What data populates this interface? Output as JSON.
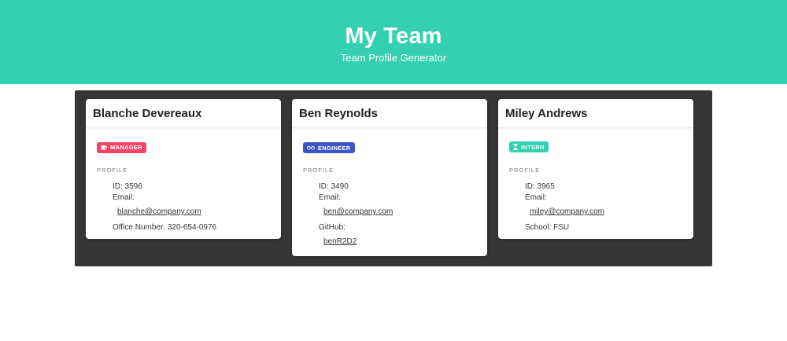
{
  "header": {
    "title": "My Team",
    "subtitle": "Team Profile Generator",
    "background": "#33d0b1"
  },
  "board": {
    "background": "#363636"
  },
  "profile_label": "PROFILE",
  "employees": [
    {
      "name": "Blanche Devereaux",
      "role": "MANAGER",
      "role_icon": "coffee-icon",
      "role_color": "#f14668",
      "id_text": "ID: 3596",
      "email_label": "Email:",
      "email": "blanche@company.com",
      "extra_text": "Office Number: 320-654-0976"
    },
    {
      "name": "Ben Reynolds",
      "role": "ENGINEER",
      "role_icon": "glasses-icon",
      "role_color": "#3e56c4",
      "id_text": "ID: 3490",
      "email_label": "Email:",
      "email": "ben@company.com",
      "github_label": "GitHub:",
      "github": "benR2D2"
    },
    {
      "name": "Miley Andrews",
      "role": "INTERN",
      "role_icon": "hourglass-icon",
      "role_color": "#33d0b1",
      "id_text": "ID: 3965",
      "email_label": "Email:",
      "email": "miley@company.com",
      "extra_text": "School: FSU"
    }
  ]
}
